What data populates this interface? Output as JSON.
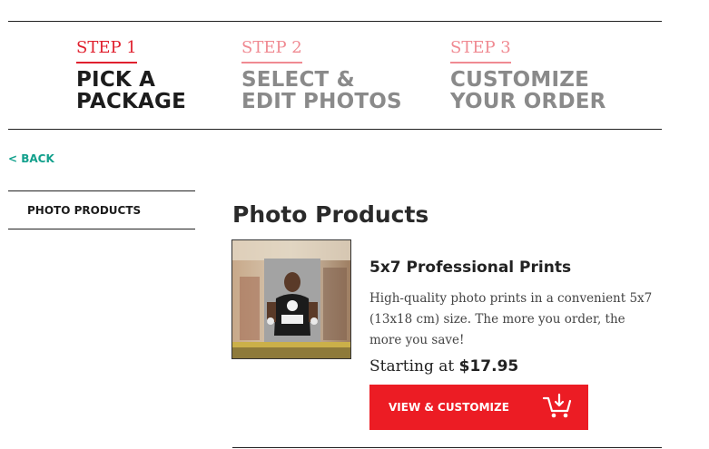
{
  "steps": [
    {
      "number": "STEP 1",
      "title_line1": "PICK A",
      "title_line2": "PACKAGE",
      "active": true
    },
    {
      "number": "STEP 2",
      "title_line1": "SELECT &",
      "title_line2": "EDIT PHOTOS",
      "active": false
    },
    {
      "number": "STEP 3",
      "title_line1": "CUSTOMIZE",
      "title_line2": "YOUR ORDER",
      "active": false
    }
  ],
  "nav": {
    "back_label": "< BACK"
  },
  "sidebar": {
    "items": [
      {
        "label": "PHOTO PRODUCTS"
      }
    ]
  },
  "main": {
    "title": "Photo Products",
    "product": {
      "name": "5x7 Professional Prints",
      "description": "High-quality photo prints in a convenient 5x7 (13x18 cm) size. The more you order, the more you save!",
      "price_prefix": "Starting at",
      "price": "$17.95",
      "cta_label": "VIEW & CUSTOMIZE",
      "cta_icon": "cart-add-icon",
      "image": "runner-photo"
    }
  },
  "colors": {
    "accent_red": "#ec1c24",
    "step_active": "#e0202e",
    "step_inactive": "#f08a92",
    "link_teal": "#12a08c"
  }
}
